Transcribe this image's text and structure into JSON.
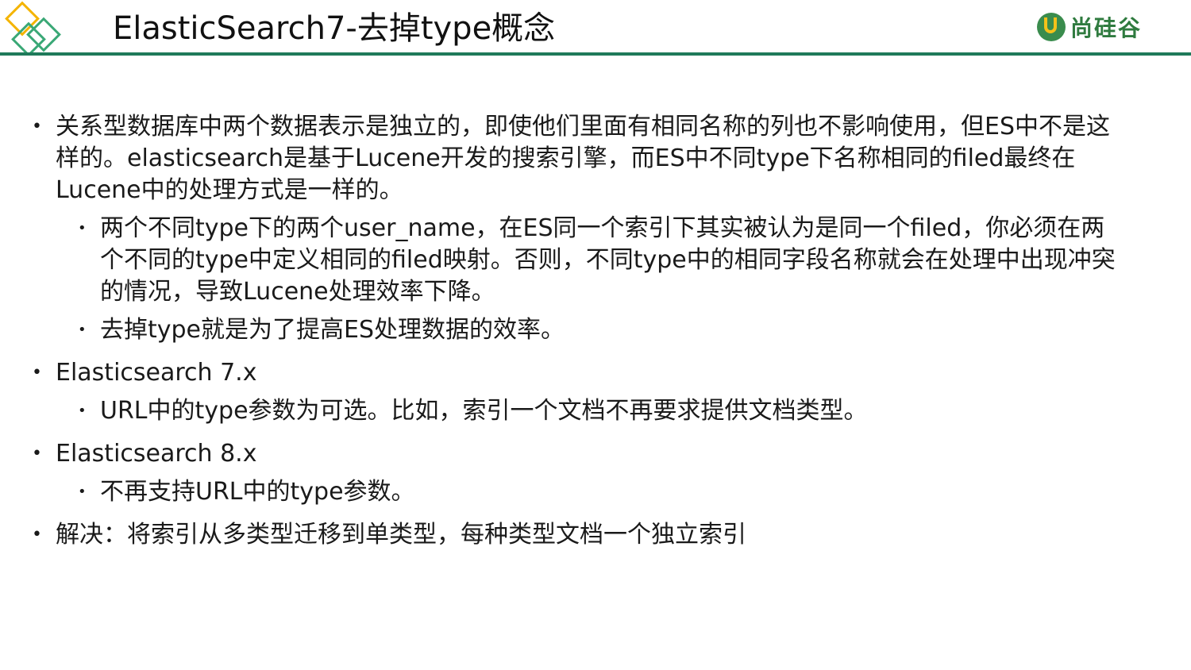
{
  "header": {
    "title": "ElasticSearch7-去掉type概念",
    "brand_text": "尚硅谷",
    "brand_icon": "cup-logo-icon",
    "accent_color": "#1f7a5a"
  },
  "bullets": [
    {
      "level": 1,
      "text": "关系型数据库中两个数据表示是独立的，即使他们里面有相同名称的列也不影响使用，但ES中不是这样的。elasticsearch是基于Lucene开发的搜索引擎，而ES中不同type下名称相同的filed最终在Lucene中的处理方式是一样的。"
    },
    {
      "level": 2,
      "text": "两个不同type下的两个user_name，在ES同一个索引下其实被认为是同一个filed，你必须在两个不同的type中定义相同的filed映射。否则，不同type中的相同字段名称就会在处理中出现冲突的情况，导致Lucene处理效率下降。"
    },
    {
      "level": 2,
      "text": "去掉type就是为了提高ES处理数据的效率。"
    },
    {
      "level": 1,
      "text": "Elasticsearch 7.x"
    },
    {
      "level": 2,
      "text": "URL中的type参数为可选。比如，索引一个文档不再要求提供文档类型。"
    },
    {
      "level": 1,
      "text": "Elasticsearch 8.x"
    },
    {
      "level": 2,
      "text": "不再支持URL中的type参数。"
    },
    {
      "level": 1,
      "text": "解决：将索引从多类型迁移到单类型，每种类型文档一个独立索引"
    }
  ],
  "bullet_glyph": "•"
}
